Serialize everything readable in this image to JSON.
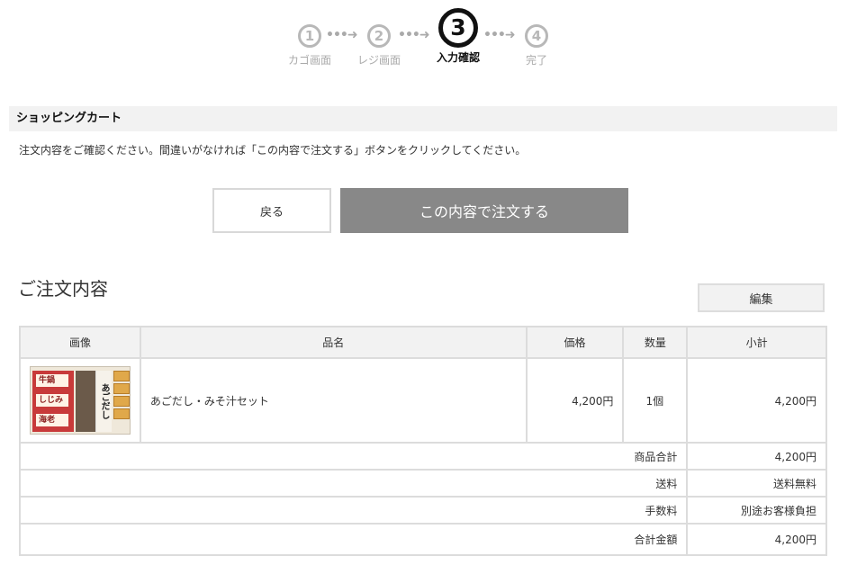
{
  "steps": [
    {
      "number": "1",
      "label": "カゴ画面",
      "active": false
    },
    {
      "number": "2",
      "label": "レジ画面",
      "active": false
    },
    {
      "number": "3",
      "label": "入力確認",
      "active": true
    },
    {
      "number": "4",
      "label": "完了",
      "active": false
    }
  ],
  "section": {
    "title": "ショッピングカート",
    "notice": "注文内容をご確認ください。間違いがなければ「この内容で注文する」ボタンをクリックしてください。"
  },
  "buttons": {
    "back": "戻る",
    "order": "この内容で注文する",
    "edit": "編集"
  },
  "order": {
    "title": "ご注文内容",
    "headers": {
      "image": "画像",
      "name": "品名",
      "price": "価格",
      "qty": "数量",
      "subtotal": "小計"
    },
    "items": [
      {
        "name": "あごだし・みそ汁セット",
        "price": "4,200円",
        "qty": "1個",
        "subtotal": "4,200円"
      }
    ],
    "summary": {
      "goods_total_label": "商品合計",
      "goods_total": "4,200円",
      "shipping_label": "送料",
      "shipping": "送料無料",
      "fee_label": "手数料",
      "fee": "別途お客様負担",
      "grand_total_label": "合計金額",
      "grand_total": "4,200円"
    }
  },
  "icons": {
    "step_arrow": "dotted-arrow-icon",
    "product_thumbnail": "product-image"
  },
  "colors": {
    "order_button": "#888888",
    "section_bg": "#f2f2f2",
    "inactive_step": "#b8b8b8",
    "active_step": "#111111"
  }
}
